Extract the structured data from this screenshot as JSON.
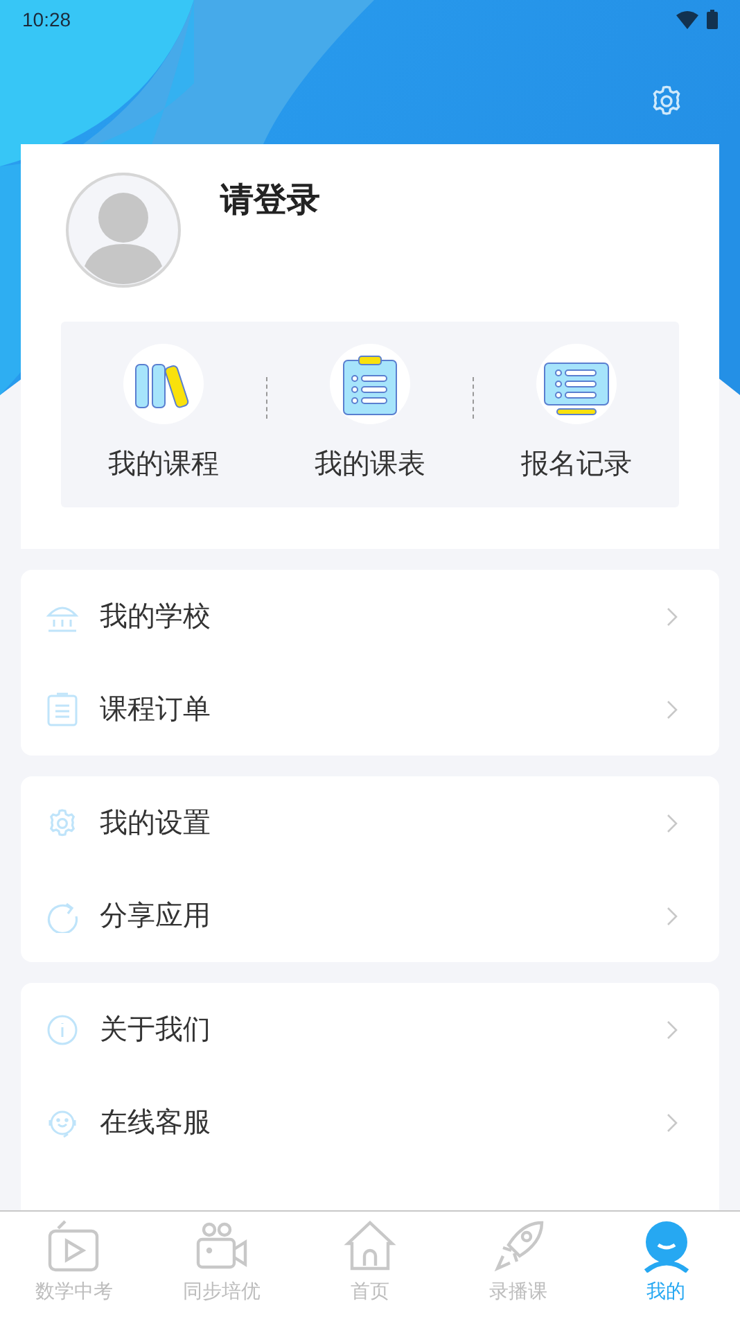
{
  "status_bar": {
    "time": "10:28"
  },
  "profile": {
    "login_prompt": "请登录"
  },
  "shortcuts": [
    {
      "label": "我的课程"
    },
    {
      "label": "我的课表"
    },
    {
      "label": "报名记录"
    }
  ],
  "menu_groups": [
    {
      "items": [
        {
          "label": "我的学校"
        },
        {
          "label": "课程订单"
        }
      ]
    },
    {
      "items": [
        {
          "label": "我的设置"
        },
        {
          "label": "分享应用"
        }
      ]
    },
    {
      "items": [
        {
          "label": "关于我们"
        },
        {
          "label": "在线客服"
        }
      ]
    }
  ],
  "tab_bar": [
    {
      "label": "数学中考",
      "selected": false
    },
    {
      "label": "同步培优",
      "selected": false
    },
    {
      "label": "首页",
      "selected": false
    },
    {
      "label": "录播课",
      "selected": false
    },
    {
      "label": "我的",
      "selected": true
    }
  ]
}
